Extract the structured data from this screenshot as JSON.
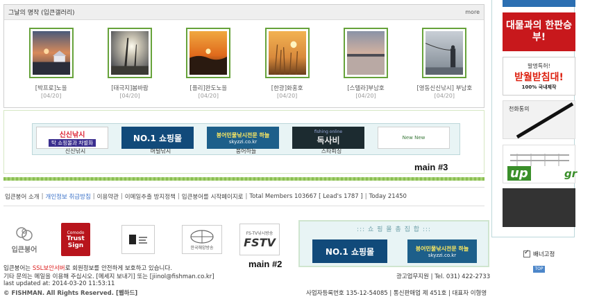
{
  "gallery": {
    "title": "그날의 명작 (입큰갤러리)",
    "more": "more",
    "items": [
      {
        "label": "[박프로]노을",
        "date": "[04/20]"
      },
      {
        "label": "[태극지]봄바람",
        "date": "[04/20]"
      },
      {
        "label": "[플리]완도노을",
        "date": "[04/20]"
      },
      {
        "label": "[한광]화홍호",
        "date": "[04/20]"
      },
      {
        "label": "[스텔라]부남호",
        "date": "[04/20]"
      },
      {
        "label": "[영동신신낚시] 부남호",
        "date": "[04/20]"
      }
    ]
  },
  "banner_strip": {
    "items": [
      {
        "img_text": "신신낚시",
        "sub": "탁 쇼핑몰과 차별화",
        "caption": "신신낚시"
      },
      {
        "img_text": "NO.1 쇼핑몰",
        "caption": "머털낚시"
      },
      {
        "img_text": "붕어민물낚시전문 하늘",
        "sub": "skyzzi.co.kr",
        "caption": "붕어하늘"
      },
      {
        "img_text": "독사비",
        "sub": "fishing online",
        "caption": "스타피싱"
      },
      {
        "img_text": "New New",
        "caption": ""
      }
    ],
    "label": "main #3"
  },
  "footer_links": [
    {
      "text": "입큰붕어 소개",
      "highlight": false
    },
    {
      "text": "개인정보 취급방침",
      "highlight": true
    },
    {
      "text": "이용약관",
      "highlight": false
    },
    {
      "text": "이메일추출 방지정책",
      "highlight": false
    },
    {
      "text": "입큰붕어를 시작페이지로",
      "highlight": false
    },
    {
      "text": "Total Members 103667 [ Lead's 1787 ]",
      "highlight": false
    },
    {
      "text": "Today 21450",
      "highlight": false
    }
  ],
  "logos": {
    "ipkeun": "입큰붕어",
    "trustsign_small": "Comodo",
    "trustsign_main": "Trust Sign",
    "huge": "한국해양방송",
    "fstv_top": "FS-TV낚시방송",
    "fstv": "FSTV",
    "label": "main #2"
  },
  "shop2": {
    "title": "::: 쇼 핑 몰  총 집 합 :::",
    "left": "NO.1 쇼핑몰",
    "right": "붕어민물낚시전문 하늘",
    "right_sub": "skyzzi.co.kr"
  },
  "footer": {
    "line1_pre": "입큰붕어는 ",
    "line1_ssl": "SSL보안서버",
    "line1_post": "로 회원정보를 안전하게 보호하고 있습니다.",
    "line2": "기타 문의는 메일을 이용해 주십시오. [메세지 보내기] 또는 [jiinol@fishman.co.kr]",
    "updated": "last updated at: 2014-03-20 11:53:11",
    "copyright": "© FISHMAN. All Rights Reserved. [웹하드]",
    "ad_contact": "광고업무지원 | Tel. 031) 422-2733",
    "biz": "사업자등록번호 135-12-54085 | 통신판매업 제 451호 | 대표자 이형영"
  },
  "side": {
    "ad1": "대물과의 한판승부!",
    "ad2_top": "발명특허!",
    "ad2_main": "받월받침대!",
    "ad2_bottom": "100% 국내제작",
    "ad3": "천화통의",
    "ad4_up": "up",
    "ad4_gr": "gr",
    "fix_label": "배너고정",
    "top_label": "TOP"
  },
  "colors": {
    "accent_green": "#66a23a",
    "strip_bg": "#e8f4f5",
    "link_blue": "#3a71c8"
  }
}
